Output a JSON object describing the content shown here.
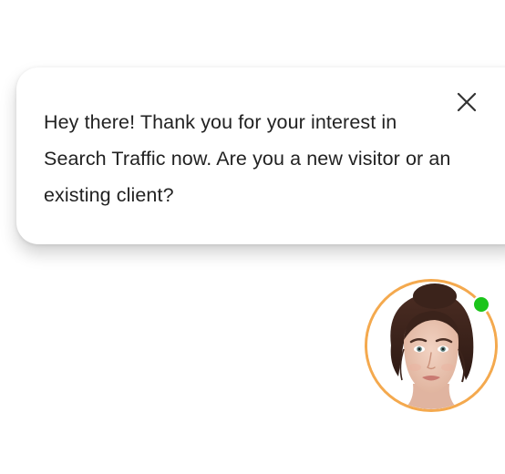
{
  "chat": {
    "message": "Hey there! Thank you for your interest in Search Traffic now. Are you a new visitor or an existing client?",
    "close_icon": "close-icon"
  },
  "agent": {
    "avatar_icon": "agent-avatar",
    "status": "online",
    "status_color": "#1bc41b",
    "ring_color": "#f4a94e"
  }
}
